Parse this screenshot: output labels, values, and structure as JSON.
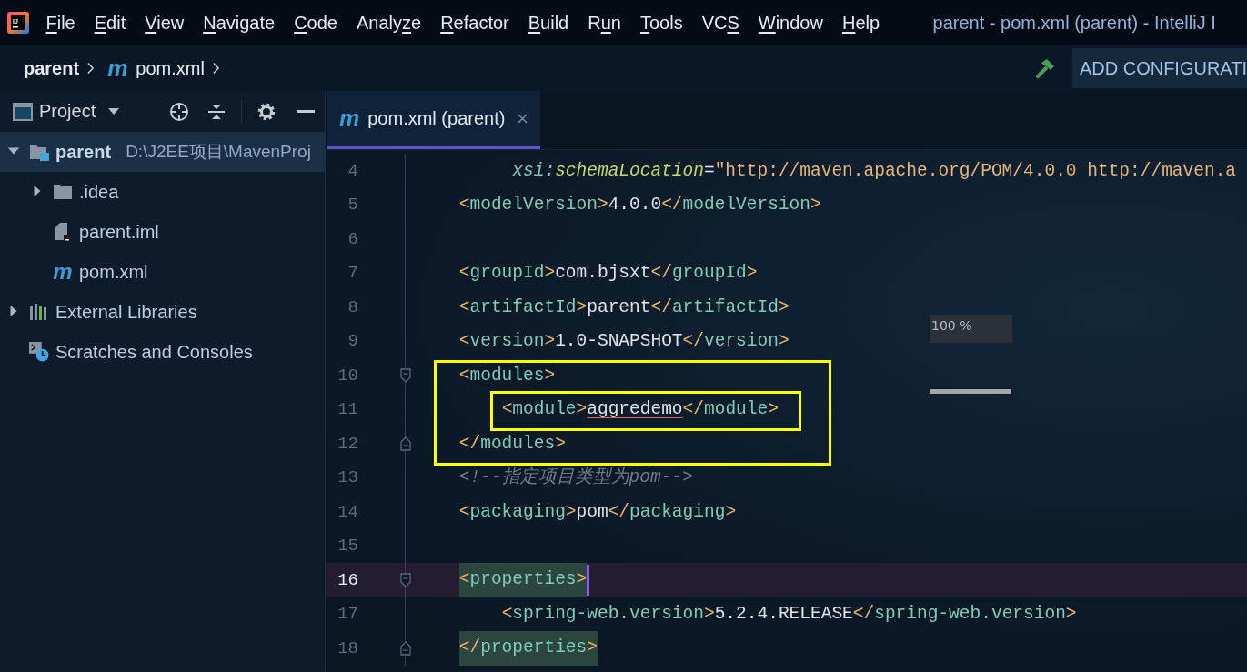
{
  "menu_bar": {
    "logo_text": "IJ",
    "items": [
      {
        "key": "F",
        "rest": "ile"
      },
      {
        "key": "E",
        "rest": "dit"
      },
      {
        "key": "V",
        "rest": "iew"
      },
      {
        "key": "N",
        "rest": "avigate"
      },
      {
        "key": "C",
        "rest": "ode"
      },
      {
        "pre": "Analy",
        "key": "z",
        "rest": "e"
      },
      {
        "key": "R",
        "rest": "efactor"
      },
      {
        "key": "B",
        "rest": "uild"
      },
      {
        "pre": "R",
        "key": "u",
        "rest": "n"
      },
      {
        "key": "T",
        "rest": "ools"
      },
      {
        "pre": "VC",
        "key": "S"
      },
      {
        "key": "W",
        "rest": "indow"
      },
      {
        "key": "H",
        "rest": "elp"
      }
    ],
    "title": "parent - pom.xml (parent) - IntelliJ I"
  },
  "navigation_bar": {
    "breadcrumbs": [
      {
        "label": "parent",
        "bold": true
      },
      {
        "label": "pom.xml",
        "file_icon": "m",
        "bold": false
      }
    ],
    "run_config_button": "ADD CONFIGURATI"
  },
  "project_panel": {
    "title": "Project",
    "tree": [
      {
        "label": "parent",
        "path": "D:\\J2EE项目\\MavenProj",
        "kind": "module",
        "expanded": true,
        "selected": true,
        "children": [
          {
            "label": ".idea",
            "kind": "folder",
            "expanded": false,
            "selected": false
          },
          {
            "label": "parent.iml",
            "kind": "iml",
            "selected": false
          },
          {
            "label": "pom.xml",
            "kind": "maven",
            "file_icon": "m",
            "selected": false
          }
        ]
      },
      {
        "label": "External Libraries",
        "kind": "libraries",
        "expanded": false,
        "selected": false
      },
      {
        "label": "Scratches and Consoles",
        "kind": "scratches",
        "selected": false
      }
    ]
  },
  "editor": {
    "tabs": [
      {
        "label": "pom.xml (parent)",
        "file_icon": "m",
        "selected": true
      }
    ],
    "lines": [
      {
        "kind": "line",
        "number": "4",
        "tokens": [
          {
            "kind": "attr_ns",
            "text": "         xsi:"
          },
          {
            "kind": "attr",
            "text": "schemaLocation"
          },
          {
            "kind": "punct",
            "text": "="
          },
          {
            "kind": "value",
            "text": "\"http://maven.apache.org/POM/4.0.0 http://maven.a"
          }
        ],
        "current": false,
        "match": false
      },
      {
        "kind": "line",
        "number": "5",
        "tokens": [
          {
            "kind": "bracket",
            "text": "    <"
          },
          {
            "kind": "tag",
            "text": "modelVersion"
          },
          {
            "kind": "bracket",
            "text": ">"
          },
          {
            "kind": "text",
            "text": "4.0.0"
          },
          {
            "kind": "bracket",
            "text": "</"
          },
          {
            "kind": "tag",
            "text": "modelVersion"
          },
          {
            "kind": "bracket",
            "text": ">"
          }
        ],
        "current": false,
        "match": false
      },
      {
        "kind": "line",
        "number": "6",
        "current": false
      },
      {
        "kind": "line",
        "number": "7",
        "tokens": [
          {
            "kind": "bracket",
            "text": "    <"
          },
          {
            "kind": "tag",
            "text": "groupId"
          },
          {
            "kind": "bracket",
            "text": ">"
          },
          {
            "kind": "text",
            "text": "com.bjsxt"
          },
          {
            "kind": "bracket",
            "text": "</"
          },
          {
            "kind": "tag",
            "text": "groupId"
          },
          {
            "kind": "bracket",
            "text": ">"
          }
        ],
        "current": false,
        "match": false
      },
      {
        "kind": "line",
        "number": "8",
        "tokens": [
          {
            "kind": "bracket",
            "text": "    <"
          },
          {
            "kind": "tag",
            "text": "artifactId"
          },
          {
            "kind": "bracket",
            "text": ">"
          },
          {
            "kind": "text",
            "text": "parent"
          },
          {
            "kind": "bracket",
            "text": "</"
          },
          {
            "kind": "tag",
            "text": "artifactId"
          },
          {
            "kind": "bracket",
            "text": ">"
          }
        ],
        "current": false,
        "match": false
      },
      {
        "kind": "line",
        "number": "9",
        "tokens": [
          {
            "kind": "bracket",
            "text": "    <"
          },
          {
            "kind": "tag",
            "text": "version"
          },
          {
            "kind": "bracket",
            "text": ">"
          },
          {
            "kind": "text",
            "text": "1.0-SNAPSHOT"
          },
          {
            "kind": "bracket",
            "text": "</"
          },
          {
            "kind": "tag",
            "text": "version"
          },
          {
            "kind": "bracket",
            "text": ">"
          }
        ],
        "current": false,
        "match": false
      },
      {
        "kind": "annotation_group",
        "lines": [
          {
            "kind": "line",
            "number": "10",
            "tokens": [
              {
                "kind": "bracket",
                "text": "    <"
              },
              {
                "kind": "tag",
                "text": "modules"
              },
              {
                "kind": "bracket",
                "text": ">"
              }
            ],
            "current": false,
            "match": false,
            "fold": {
              "kind": "start"
            }
          },
          {
            "kind": "boxed_line",
            "number": "11",
            "tokens": [
              {
                "kind": "bracket",
                "text": "        <"
              },
              {
                "kind": "tag",
                "text": "module"
              },
              {
                "kind": "bracket",
                "text": ">"
              },
              {
                "kind": "misspelled",
                "text": "aggredemo"
              },
              {
                "kind": "bracket",
                "text": "</"
              },
              {
                "kind": "tag",
                "text": "module"
              },
              {
                "kind": "bracket",
                "text": ">"
              }
            ],
            "current": false,
            "match": false
          },
          {
            "kind": "line",
            "number": "12",
            "tokens": [
              {
                "kind": "bracket",
                "text": "    </"
              },
              {
                "kind": "tag",
                "text": "modules"
              },
              {
                "kind": "bracket",
                "text": ">"
              }
            ],
            "current": false,
            "match": false,
            "fold": {
              "kind": "end"
            }
          }
        ]
      },
      {
        "kind": "line",
        "number": "13",
        "tokens": [
          {
            "kind": "comment",
            "text": "    <!--指定项目类型为pom-->"
          }
        ],
        "current": false,
        "match": false
      },
      {
        "kind": "line",
        "number": "14",
        "tokens": [
          {
            "kind": "bracket",
            "text": "    <"
          },
          {
            "kind": "tag",
            "text": "packaging"
          },
          {
            "kind": "bracket",
            "text": ">"
          },
          {
            "kind": "text",
            "text": "pom"
          },
          {
            "kind": "bracket",
            "text": "</"
          },
          {
            "kind": "tag",
            "text": "packaging"
          },
          {
            "kind": "bracket",
            "text": ">"
          }
        ],
        "current": false,
        "match": false
      },
      {
        "kind": "line",
        "number": "15",
        "current": false
      },
      {
        "kind": "line",
        "number": "16",
        "tokens": [
          {
            "kind": "bracket",
            "text": "    <"
          },
          {
            "kind": "tag",
            "text": "properties"
          },
          {
            "kind": "bracket",
            "text": ">"
          }
        ],
        "current": true,
        "match": true,
        "fold": {
          "kind": "start"
        }
      },
      {
        "kind": "line",
        "number": "17",
        "tokens": [
          {
            "kind": "bracket",
            "text": "        <"
          },
          {
            "kind": "tag",
            "text": "spring-web.version"
          },
          {
            "kind": "bracket",
            "text": ">"
          },
          {
            "kind": "text",
            "text": "5.2.4.RELEASE"
          },
          {
            "kind": "bracket",
            "text": "</"
          },
          {
            "kind": "tag",
            "text": "spring-web.version"
          },
          {
            "kind": "bracket",
            "text": ">"
          }
        ],
        "current": false,
        "match": false
      },
      {
        "kind": "line",
        "number": "18",
        "tokens": [
          {
            "kind": "bracket",
            "text": "    </"
          },
          {
            "kind": "tag",
            "text": "properties"
          },
          {
            "kind": "bracket",
            "text": ">"
          }
        ],
        "current": false,
        "match": true,
        "fold": {
          "kind": "end"
        }
      }
    ],
    "overlay": {
      "label": "100 %",
      "level": 1
    }
  }
}
